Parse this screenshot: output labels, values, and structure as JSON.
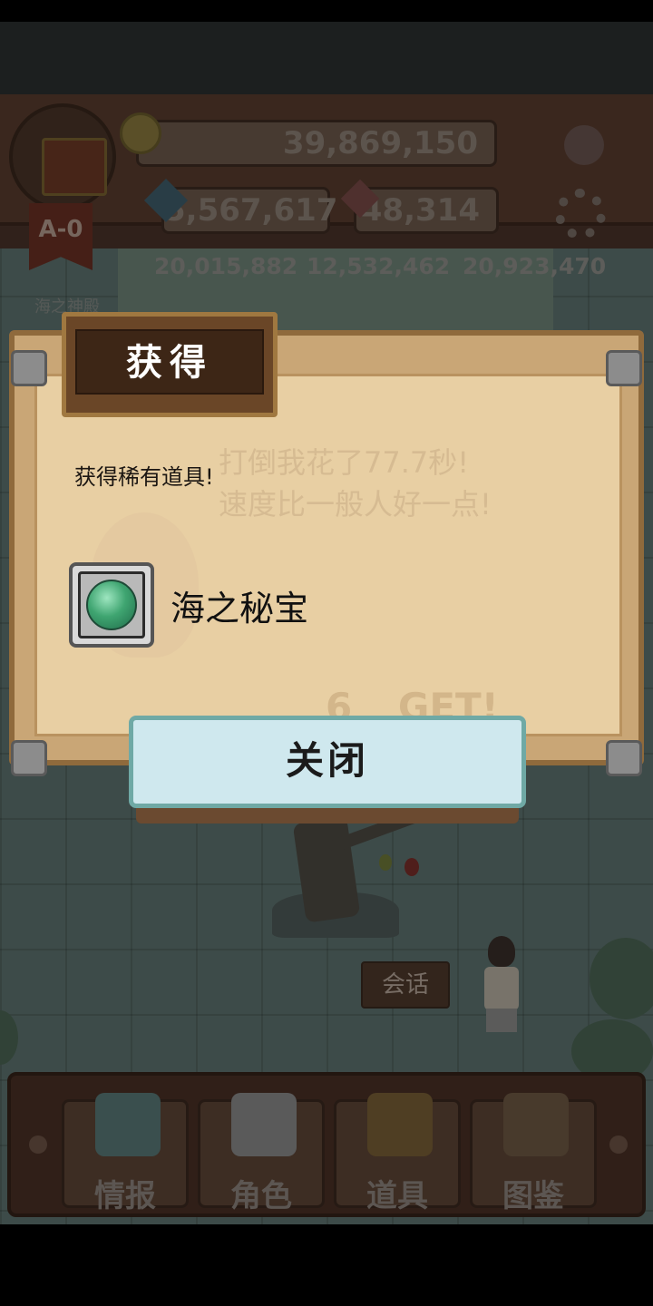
{
  "hud": {
    "gold": "39,869,150",
    "blue_gems": "5,567,617",
    "red_gems": "48,314",
    "rank_badge": "A-0",
    "stat_1": "20,015,882",
    "stat_2": "12,532,462",
    "stat_3": "20,923,470",
    "map_name": "海之神殿"
  },
  "scene": {
    "talk_button": "会话"
  },
  "dialog": {
    "title": "获得",
    "message": "获得稀有道具!",
    "item_name": "海之秘宝",
    "close_button": "关闭",
    "background_line_1": "打倒我花了77.7秒!",
    "background_line_2": "速度比一般人好一点!",
    "background_get_count": "6",
    "background_get_text": "GET!"
  },
  "menu": {
    "items": [
      {
        "label": "情报",
        "icon": "info-icon"
      },
      {
        "label": "角色",
        "icon": "character-icon"
      },
      {
        "label": "道具",
        "icon": "item-chest-icon"
      },
      {
        "label": "图鉴",
        "icon": "encyclopedia-icon"
      }
    ]
  },
  "colors": {
    "close_button_bg": "#cfe8ee",
    "parchment": "#e8cfa3",
    "title_plate": "#3d2616"
  }
}
